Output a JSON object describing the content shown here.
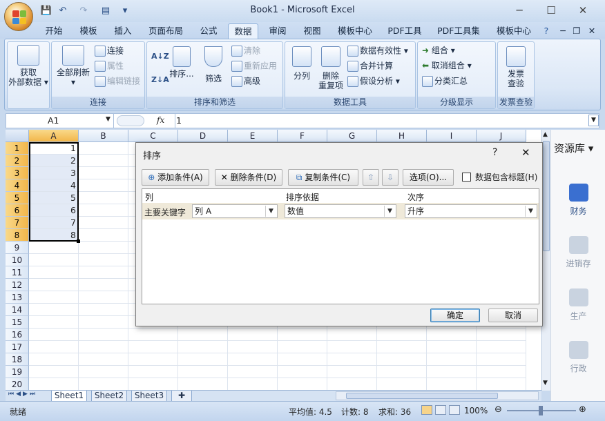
{
  "window": {
    "title": "Book1 - Microsoft Excel",
    "minimize": "─",
    "maximize": "☐",
    "close": "✕"
  },
  "tabs": [
    "开始",
    "模板",
    "插入",
    "页面布局",
    "公式",
    "数据",
    "审阅",
    "视图",
    "模板中心",
    "PDF工具",
    "PDF工具集",
    "模板中心"
  ],
  "active_tab": "数据",
  "ribbon": {
    "external": {
      "label1": "获取",
      "label2": "外部数据 ▾"
    },
    "connections": {
      "group": "连接",
      "refresh1": "全部刷新",
      "refresh2": "▾",
      "connect": "连接",
      "properties": "属性",
      "edit_links": "编辑链接"
    },
    "sortfilter": {
      "group": "排序和筛选",
      "az": "A↓Z",
      "za": "Z↓A",
      "sort": "排序...",
      "filter": "筛选",
      "clear": "清除",
      "reapply": "重新应用",
      "advanced": "高级"
    },
    "datatools": {
      "group": "数据工具",
      "split": "分列",
      "remove1": "删除",
      "remove2": "重复项",
      "validation": "数据有效性 ▾",
      "consolidate": "合并计算",
      "whatif": "假设分析 ▾"
    },
    "outline": {
      "group": "分级显示",
      "group_btn": "组合 ▾",
      "ungroup": "取消组合 ▾",
      "subtotal": "分类汇总"
    },
    "invoice": {
      "group": "发票查验",
      "btn1": "发票",
      "btn2": "查验"
    }
  },
  "formula_bar": {
    "name_box": "A1",
    "fx": "fx",
    "value": "1"
  },
  "columns": [
    "A",
    "B",
    "C",
    "D",
    "E",
    "F",
    "G",
    "H",
    "I",
    "J"
  ],
  "rows": [
    "1",
    "2",
    "3",
    "4",
    "5",
    "6",
    "7",
    "8",
    "9",
    "10",
    "11",
    "12",
    "13",
    "14",
    "15",
    "16",
    "17",
    "18",
    "19",
    "20"
  ],
  "column_a_values": [
    "1",
    "2",
    "3",
    "4",
    "5",
    "6",
    "7",
    "8"
  ],
  "dialog": {
    "title": "排序",
    "help": "?",
    "close": "✕",
    "add": "添加条件(A)",
    "delete": "删除条件(D)",
    "copy": "复制条件(C)",
    "up": "⇧",
    "down": "⇩",
    "options": "选项(O)...",
    "has_header": "数据包含标题(H)",
    "col_header": "列",
    "basis_header": "排序依据",
    "order_header": "次序",
    "row_label": "主要关键字",
    "column_value": "列 A",
    "basis_value": "数值",
    "order_value": "升序",
    "ok": "确定",
    "cancel": "取消"
  },
  "sheets": [
    "Sheet1",
    "Sheet2",
    "Sheet3"
  ],
  "status": {
    "ready": "就绪",
    "average": "平均值: 4.5",
    "count": "计数: 8",
    "sum": "求和: 36",
    "zoom": "100%"
  },
  "side_panel": {
    "title": "资源库 ▾",
    "items": [
      "财务",
      "进销存",
      "生产",
      "行政"
    ]
  }
}
